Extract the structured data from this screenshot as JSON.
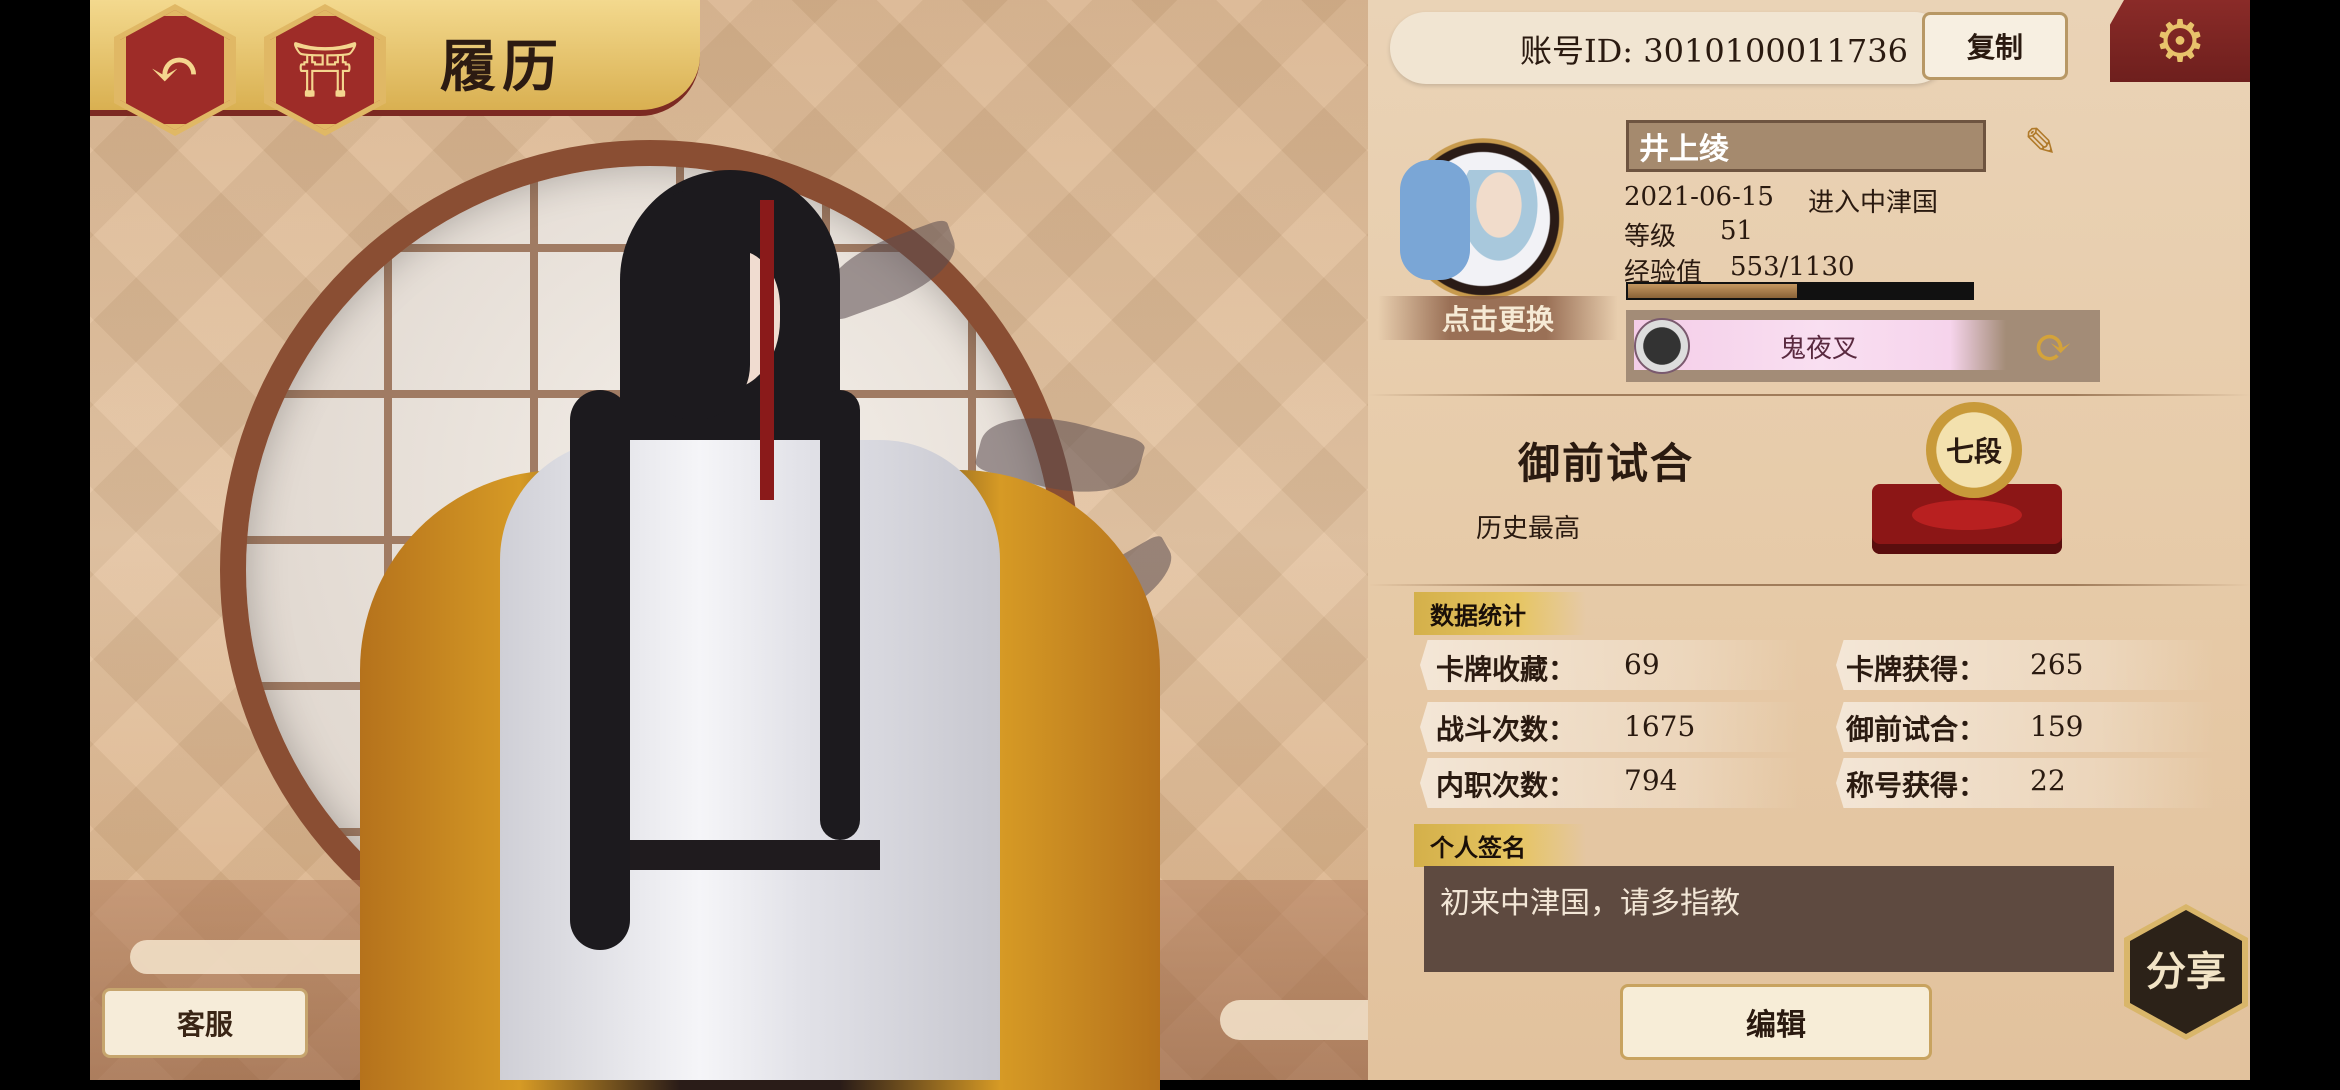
{
  "header": {
    "title": "履历",
    "back_icon": "back-arrow-icon",
    "home_icon": "shrine-gate-icon"
  },
  "left": {
    "support_label": "客服"
  },
  "account": {
    "id_text": "账号ID: 3010100011736",
    "copy_label": "复制",
    "settings_icon": "gear-icon"
  },
  "profile": {
    "name": "井上绫",
    "change_avatar_label": "点击更换",
    "join_date": "2021-06-15",
    "join_text": "进入中津国",
    "level_label": "等级",
    "level_value": "51",
    "exp_label": "经验值",
    "exp_value": "553/1130",
    "exp_fraction": 0.49,
    "title_name": "鬼夜叉"
  },
  "pvp": {
    "title": "御前试合",
    "subtitle": "历史最高",
    "rank_badge_text": "七段"
  },
  "stats": {
    "section_label": "数据统计",
    "items": [
      {
        "label": "卡牌收藏：",
        "value": "69"
      },
      {
        "label": "卡牌获得：",
        "value": "265"
      },
      {
        "label": "战斗次数：",
        "value": "1675"
      },
      {
        "label": "御前试合：",
        "value": "159"
      },
      {
        "label": "内职次数：",
        "value": "794"
      },
      {
        "label": "称号获得：",
        "value": "22"
      }
    ]
  },
  "signature": {
    "section_label": "个人签名",
    "text": "初来中津国，请多指教",
    "edit_label": "编辑"
  },
  "share": {
    "label": "分享"
  }
}
